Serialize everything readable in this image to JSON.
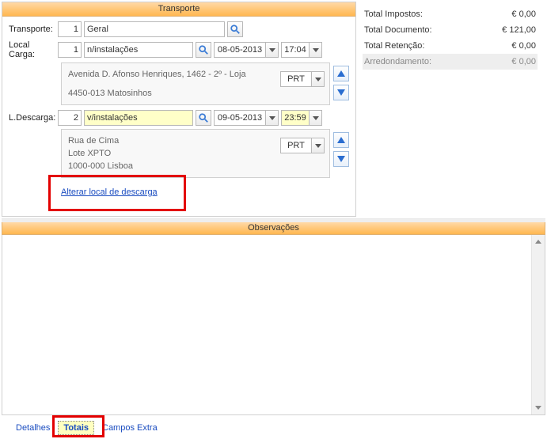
{
  "transporte": {
    "header": "Transporte",
    "transporte_label": "Transporte:",
    "transporte_num": "1",
    "transporte_text": "Geral",
    "carga_label": "Local Carga:",
    "carga_num": "1",
    "carga_text": "n/instalações",
    "carga_date": "08-05-2013",
    "carga_time": "17:04",
    "carga_addr1": "Avenida D. Afonso Henriques, 1462 - 2º - Loja",
    "carga_addr2": "4450-013 Matosinhos",
    "carga_country": "PRT",
    "descarga_label": "L.Descarga:",
    "descarga_num": "2",
    "descarga_text": "v/instalações",
    "descarga_date": "09-05-2013",
    "descarga_time": "23:59",
    "descarga_addr1": "Rua de Cima",
    "descarga_addr2": "Lote XPTO",
    "descarga_addr3": "1000-000 Lisboa",
    "descarga_country": "PRT",
    "link": "Alterar local de descarga"
  },
  "totals": {
    "impostos_label": "Total Impostos:",
    "impostos_val": "€ 0,00",
    "documento_label": "Total Documento:",
    "documento_val": "€ 121,00",
    "retencao_label": "Total Retenção:",
    "retencao_val": "€ 0,00",
    "arred_label": "Arredondamento:",
    "arred_val": "€ 0,00"
  },
  "obs": {
    "header": "Observações"
  },
  "tabs": {
    "detalhes": "Detalhes",
    "totais": "Totais",
    "extra": "Campos Extra"
  }
}
